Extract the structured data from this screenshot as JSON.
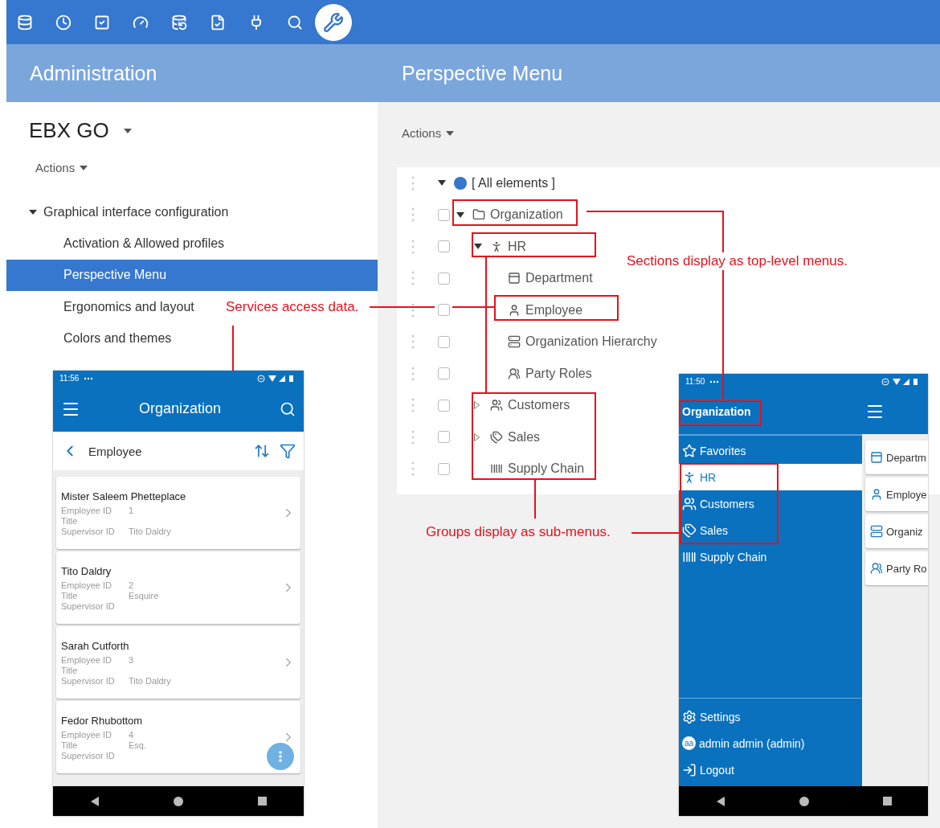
{
  "toolbar": [
    {
      "kind": "database",
      "selected": false
    },
    {
      "kind": "clock",
      "selected": false
    },
    {
      "kind": "check-square",
      "selected": false
    },
    {
      "kind": "gauge",
      "selected": false
    },
    {
      "kind": "database-edit",
      "selected": false
    },
    {
      "kind": "check-edit",
      "selected": false
    },
    {
      "kind": "plug",
      "selected": false
    },
    {
      "kind": "search",
      "selected": false
    },
    {
      "kind": "wrench",
      "selected": true
    }
  ],
  "admin": {
    "title": "Administration",
    "dataspace": "EBX GO",
    "actions": "Actions",
    "nav": {
      "label": "Graphical interface configuration",
      "expanded": true,
      "children": [
        {
          "label": "Activation & Allowed profiles",
          "selected": false
        },
        {
          "label": "Perspective Menu",
          "selected": true
        },
        {
          "label": "Ergonomics and layout",
          "selected": false
        },
        {
          "label": "Colors and themes",
          "selected": false
        }
      ]
    }
  },
  "perspective": {
    "title": "Perspective Menu",
    "actions": "Actions",
    "tree": {
      "label": "[ All elements ]",
      "kind": "dot",
      "expanded": true,
      "children": [
        {
          "label": "Organization",
          "kind": "folder",
          "checked": false,
          "expanded": true,
          "children": [
            {
              "label": "HR",
              "kind": "person",
              "checked": false,
              "expanded": true,
              "children": [
                {
                  "label": "Department",
                  "kind": "panel",
                  "checked": false
                },
                {
                  "label": "Employee",
                  "kind": "user",
                  "checked": false
                },
                {
                  "label": "Organization Hierarchy",
                  "kind": "stack",
                  "checked": false
                },
                {
                  "label": "Party Roles",
                  "kind": "people",
                  "checked": false
                }
              ]
            },
            {
              "label": "Customers",
              "kind": "users",
              "checked": false,
              "expanded": false
            },
            {
              "label": "Sales",
              "kind": "tags",
              "checked": false,
              "expanded": false
            },
            {
              "label": "Supply Chain",
              "kind": "barcode",
              "checked": false
            }
          ]
        }
      ]
    }
  },
  "annotations": [
    {
      "text": "Sections display as top-level menus."
    },
    {
      "text": "Services access data."
    },
    {
      "text": "Groups display as sub-menus."
    }
  ],
  "phone_list": {
    "time": "11:56",
    "title": "Organization",
    "subtitle": "Employee",
    "cards": [
      {
        "name": "Mister Saleem Phetteplace",
        "fields": [
          {
            "label": "Employee ID",
            "value": "1"
          },
          {
            "label": "Title"
          },
          {
            "label": "Supervisor ID",
            "value": "Tito Daldry"
          }
        ]
      },
      {
        "name": "Tito Daldry",
        "fields": [
          {
            "label": "Employee ID",
            "value": "2"
          },
          {
            "label": "Title",
            "value": "Esquire"
          },
          {
            "label": "Supervisor ID"
          }
        ]
      },
      {
        "name": "Sarah Cutforth",
        "fields": [
          {
            "label": "Employee ID",
            "value": "3"
          },
          {
            "label": "Title"
          },
          {
            "label": "Supervisor ID",
            "value": "Tito Daldry"
          }
        ]
      },
      {
        "name": "Fedor Rhubottom",
        "fields": [
          {
            "label": "Employee ID",
            "value": "4"
          },
          {
            "label": "Title",
            "value": "Esq."
          },
          {
            "label": "Supervisor ID"
          }
        ]
      }
    ]
  },
  "phone_menu": {
    "time": "11:50",
    "title": "Organization",
    "items": [
      {
        "label": "Favorites",
        "kind": "star",
        "selected": false
      },
      {
        "label": "HR",
        "kind": "person",
        "selected": true
      },
      {
        "label": "Customers",
        "kind": "users",
        "selected": false
      },
      {
        "label": "Sales",
        "kind": "tags",
        "selected": false
      },
      {
        "label": "Supply Chain",
        "kind": "barcode",
        "selected": false
      }
    ],
    "footer": [
      {
        "label": "Settings",
        "kind": "settings"
      },
      {
        "label": "admin admin (admin)",
        "kind": "avatar",
        "initials": "aa"
      },
      {
        "label": "Logout",
        "kind": "logout"
      }
    ],
    "tiles": [
      {
        "label": "Departm",
        "kind": "panel"
      },
      {
        "label": "Employe",
        "kind": "user"
      },
      {
        "label": "Organiz",
        "kind": "stack"
      },
      {
        "label": "Party Ro",
        "kind": "people"
      }
    ]
  }
}
